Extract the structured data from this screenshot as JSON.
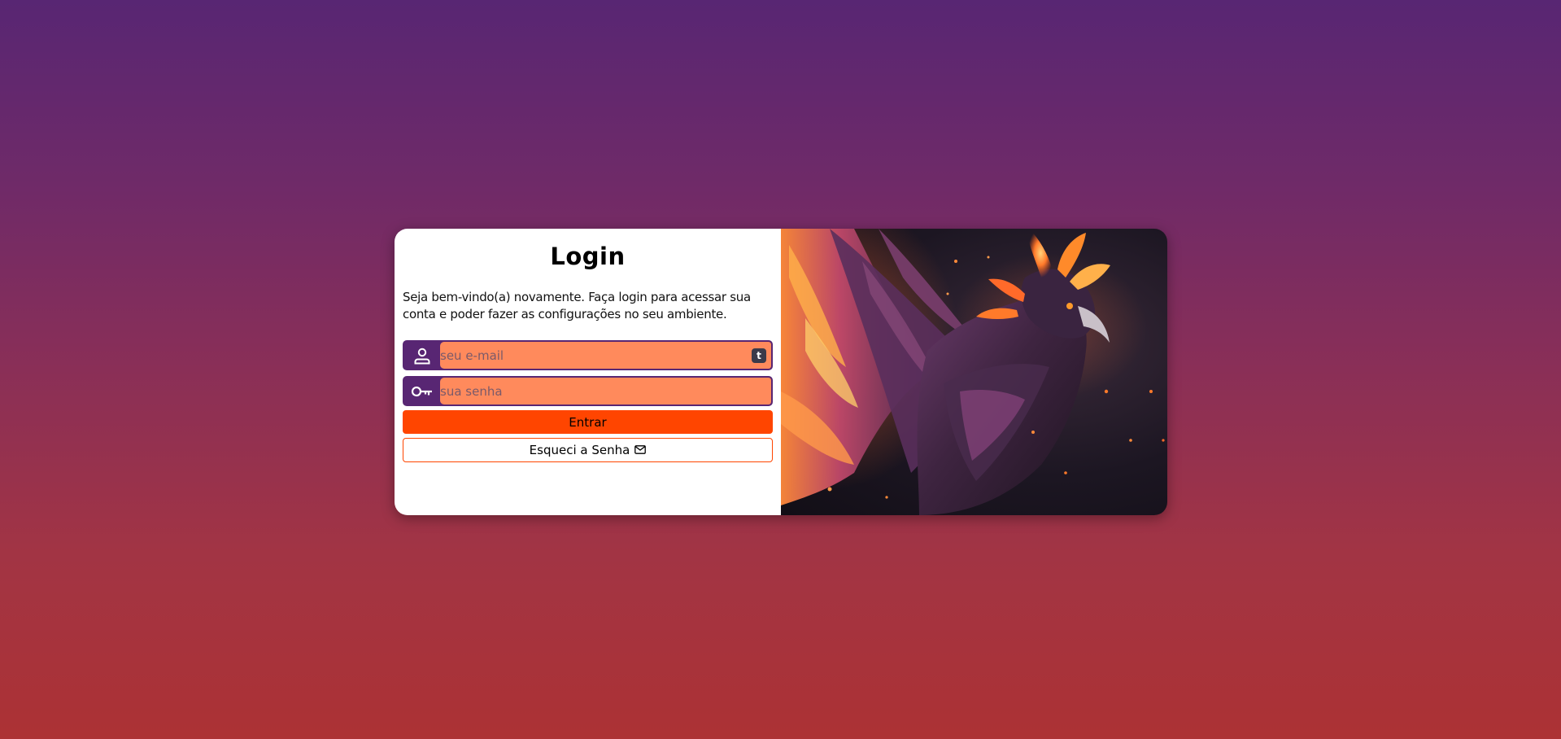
{
  "login": {
    "title": "Login",
    "welcome": "Seja bem-vindo(a) novamente. Faça login para acessar sua conta e poder fazer as configurações no seu ambiente.",
    "email": {
      "placeholder": "seu e-mail",
      "value": "",
      "icon": "user-icon",
      "extension_badge": "t"
    },
    "password": {
      "placeholder": "sua senha",
      "value": "",
      "icon": "key-icon"
    },
    "submit_label": "Entrar",
    "forgot_label": "Esqueci a Senha",
    "forgot_icon": "envelope-icon"
  },
  "colors": {
    "primary": "#582673",
    "accent": "#ff4500",
    "input_bg": "#ff8a5c",
    "gradient_top": "#582673",
    "gradient_bottom": "#ac3234"
  },
  "hero_image": {
    "subject": "phoenix-illustration"
  }
}
